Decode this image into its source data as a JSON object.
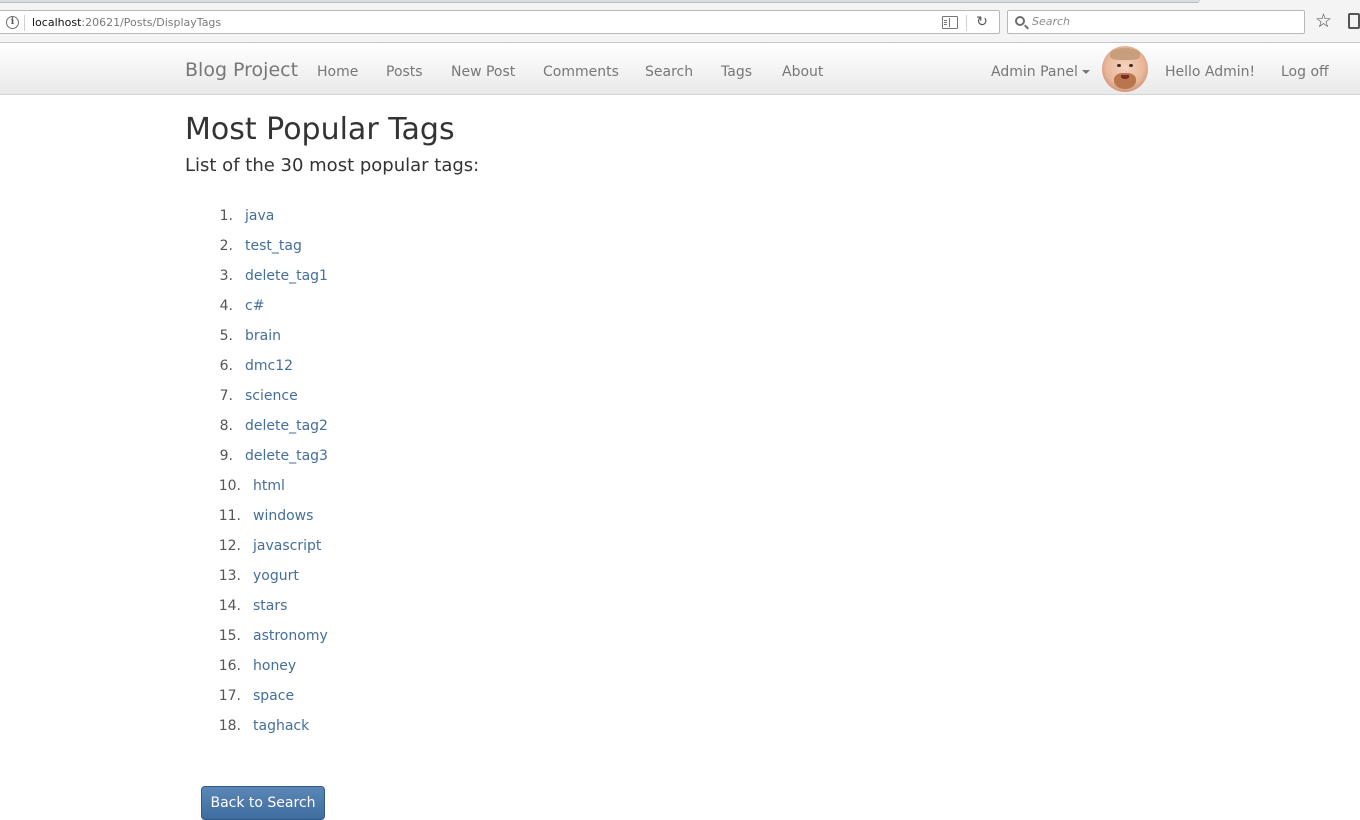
{
  "browser": {
    "url_host": "localhost",
    "url_rest": ":20621/Posts/DisplayTags",
    "search_placeholder": "Search"
  },
  "navbar": {
    "brand": "Blog Project",
    "links": [
      "Home",
      "Posts",
      "New Post",
      "Comments",
      "Search",
      "Tags",
      "About"
    ],
    "admin_panel": "Admin Panel",
    "greeting": "Hello Admin!",
    "logoff": "Log off"
  },
  "page": {
    "title": "Most Popular Tags",
    "subtitle": "List of the 30 most popular tags:",
    "tags": [
      {
        "num": "1.",
        "name": "java"
      },
      {
        "num": "2.",
        "name": "test_tag"
      },
      {
        "num": "3.",
        "name": "delete_tag1"
      },
      {
        "num": "4.",
        "name": "c#"
      },
      {
        "num": "5.",
        "name": "brain"
      },
      {
        "num": "6.",
        "name": "dmc12"
      },
      {
        "num": "7.",
        "name": "science"
      },
      {
        "num": "8.",
        "name": "delete_tag2"
      },
      {
        "num": "9.",
        "name": "delete_tag3"
      },
      {
        "num": "10.",
        "name": "html"
      },
      {
        "num": "11.",
        "name": "windows"
      },
      {
        "num": "12.",
        "name": "javascript"
      },
      {
        "num": "13.",
        "name": "yogurt"
      },
      {
        "num": "14.",
        "name": "stars"
      },
      {
        "num": "15.",
        "name": "astronomy"
      },
      {
        "num": "16.",
        "name": "honey"
      },
      {
        "num": "17.",
        "name": "space"
      },
      {
        "num": "18.",
        "name": "taghack"
      }
    ],
    "back_button": "Back to Search"
  }
}
